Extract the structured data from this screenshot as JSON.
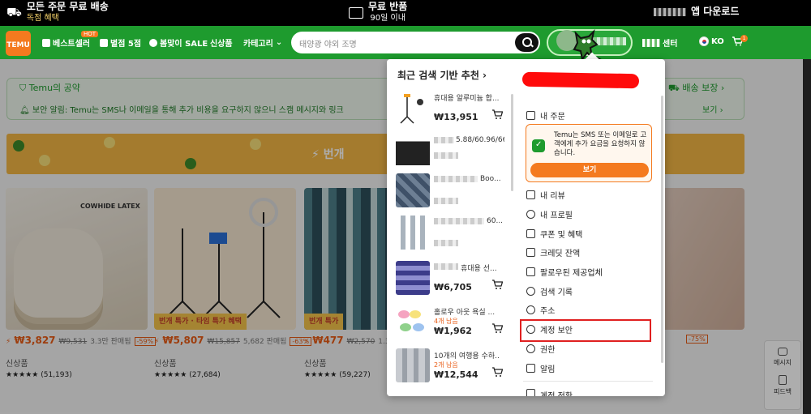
{
  "promo": {
    "shipping_title": "모든 주문 무료 배송",
    "shipping_sub": "독점 혜택",
    "returns_title": "무료 반품",
    "returns_sub": "90일 이내",
    "app_download": "앱 다운로드"
  },
  "nav": {
    "logo": "TEMU",
    "hot_badge": "HOT",
    "items": [
      "베스트셀러",
      "별점 5점",
      "봄맞이 SALE",
      "신상품",
      "카테고리"
    ],
    "search_placeholder": "태양광 야외 조명",
    "center": "센터",
    "language": "KO",
    "cart_count": "1"
  },
  "page": {
    "pledge_title": "Temu의 공약",
    "pledge_notice": "보안 알림: Temu는 SMS나 이메일을 통해 추가 비용을 요구하지 않으니 스캠 메시지와 링크",
    "delivery_guarantee": "배송 보장",
    "more": "보기",
    "banner_text": "번개",
    "products": [
      {
        "flash": "",
        "label": "COWHIDE LATEX",
        "price": "₩3,827",
        "old": "₩9,531",
        "sold": "3.3만 판매됨",
        "disc": "-59%",
        "tag": "신상품",
        "stars": "★★★★★ (51,193)"
      },
      {
        "flash": "번개 특가 · 타임 특가 혜택",
        "label": "",
        "price": "₩5,807",
        "old": "₩15,857",
        "sold": "5,682 판매됨",
        "disc": "-63%",
        "tag": "신상품",
        "stars": "★★★★★ (27,684)"
      },
      {
        "flash": "번개 특가",
        "label": "",
        "price": "₩477",
        "old": "₩2,570",
        "sold": "1.3만",
        "disc": "",
        "tag": "신상품",
        "stars": "★★★★★ (59,227)"
      }
    ],
    "right_disc": "-75%",
    "side_message": "메시지",
    "side_feedback": "피드백"
  },
  "recent": {
    "title": "최근 검색 기반 추천",
    "items": [
      {
        "name": "휴대용 알루미늄 합...",
        "sold": "",
        "price": "₩13,951"
      },
      {
        "name": "5.88/60.96/66...",
        "sold": "",
        "price": ""
      },
      {
        "name": "Boo...",
        "sold": "",
        "price": ""
      },
      {
        "name": "60...",
        "sold": "",
        "price": ""
      },
      {
        "name": "휴대용 선...",
        "sold": "",
        "price": "₩6,705"
      },
      {
        "name": "홀로우 아웃 욕실 ...",
        "sold": "4개 남음",
        "price": "₩1,962"
      },
      {
        "name": "10개의 여행용 수하...",
        "sold": "2개 남음",
        "price": "₩12,544"
      }
    ]
  },
  "menu": {
    "orders": "내 주문",
    "notice_text": "Temu는 SMS 또는 이메일로 고객에게 추가 요금을 요청하지 않습니다.",
    "notice_button": "보기",
    "items": [
      "내 리뷰",
      "내 프로필",
      "쿠폰 및 혜택",
      "크레딧 잔액",
      "팔로우된 제공업체",
      "검색 기록",
      "주소",
      "계정 보안",
      "권한",
      "알림"
    ],
    "partial": "계정 전환"
  },
  "colors": {
    "brand_green": "#1e9b2e",
    "brand_orange": "#f47a1f",
    "highlight_red": "#e02020"
  }
}
